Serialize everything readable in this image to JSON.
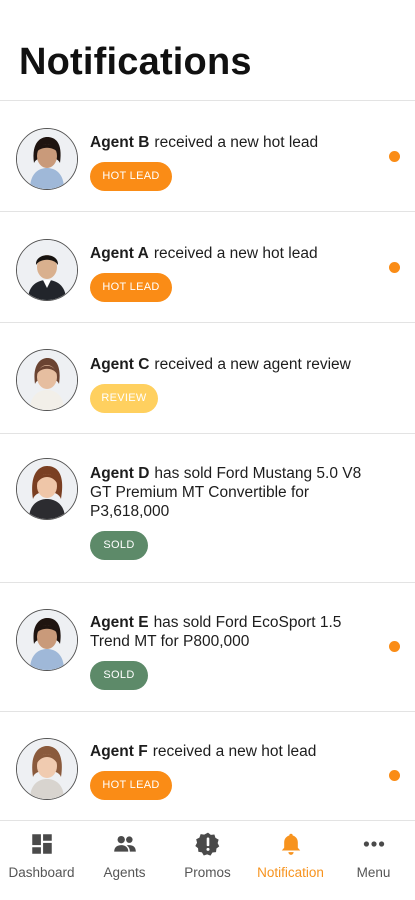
{
  "header": {
    "title": "Notifications"
  },
  "notifications": [
    {
      "agent": "Agent B",
      "message": "received a new hot lead",
      "badge": "HOT LEAD",
      "badge_type": "hot",
      "unread": true
    },
    {
      "agent": "Agent A",
      "message": "received a new hot lead",
      "badge": "HOT LEAD",
      "badge_type": "hot",
      "unread": true
    },
    {
      "agent": "Agent C",
      "message": "received a new agent review",
      "badge": "REVIEW",
      "badge_type": "review",
      "unread": false
    },
    {
      "agent": "Agent D",
      "message": "has sold Ford Mustang 5.0 V8 GT Premium MT Convertible for P3,618,000",
      "badge": "SOLD",
      "badge_type": "sold",
      "unread": false
    },
    {
      "agent": "Agent E",
      "message": "has sold Ford EcoSport 1.5 Trend MT for P800,000",
      "badge": "SOLD",
      "badge_type": "sold",
      "unread": true
    },
    {
      "agent": "Agent F",
      "message": "received a new hot lead",
      "badge": "HOT LEAD",
      "badge_type": "hot",
      "unread": true
    }
  ],
  "bottom_nav": [
    {
      "label": "Dashboard",
      "icon": "dashboard-icon",
      "active": false
    },
    {
      "label": "Agents",
      "icon": "people-icon",
      "active": false
    },
    {
      "label": "Promos",
      "icon": "promo-badge-icon",
      "active": false
    },
    {
      "label": "Notification",
      "icon": "bell-icon",
      "active": true
    },
    {
      "label": "Menu",
      "icon": "more-dots-icon",
      "active": false
    }
  ],
  "colors": {
    "accent": "#fa8c16",
    "review": "#ffd05f",
    "sold": "#5d8a69",
    "divider": "#e3e3e3"
  }
}
